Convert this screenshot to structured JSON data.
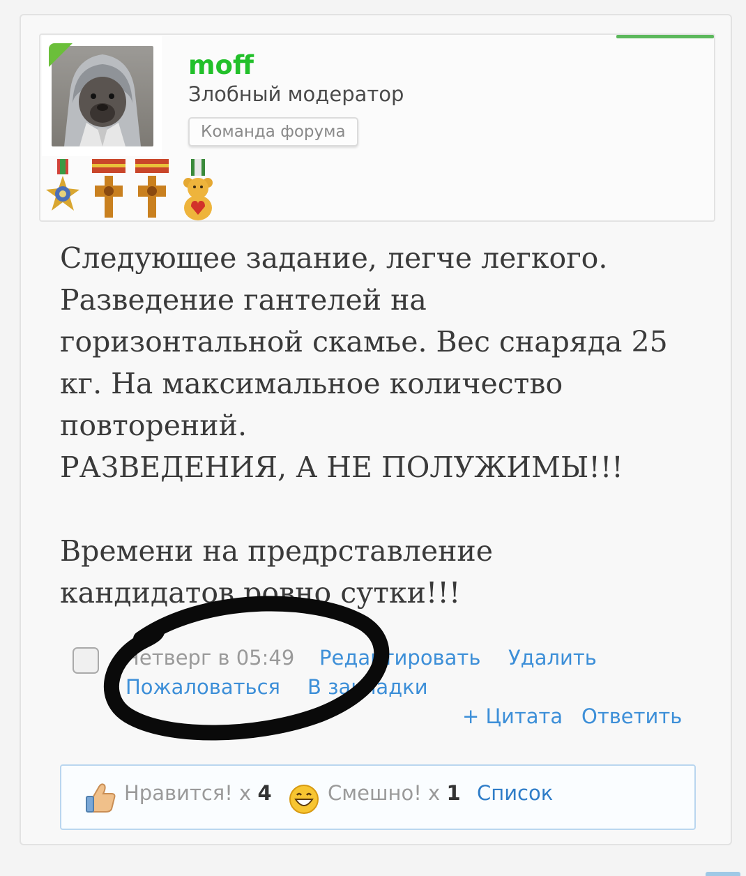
{
  "author": {
    "username": "moff",
    "title": "Злобный модератор",
    "group": "Команда форума",
    "medals": [
      "order-star-medal",
      "cross-medal",
      "cross-medal",
      "teddy-bear-medal"
    ]
  },
  "post": {
    "text": "Следующее задание, легче легкого.\nРазведение гантелей на\nгоризонтальной скамье. Вес снаряда 25\nкг. На максимальное количество\nповторений.\nРАЗВЕДЕНИЯ, А НЕ ПОЛУЖИМЫ!!!\n\nВремени на предрставление\nкандидатов ровно сутки!!!",
    "date": "Четверг в 05:49",
    "actions": {
      "edit": "Редактировать",
      "delete": "Удалить",
      "report": "Пожаловаться",
      "bookmark": "В закладки",
      "quote": "+ Цитата",
      "reply": "Ответить"
    }
  },
  "reactions": {
    "like_label": "Нравится! x",
    "like_count": "4",
    "funny_label": "Смешно! x",
    "funny_count": "1",
    "list_label": "Список"
  },
  "colors": {
    "username": "#22c02a",
    "link": "#3d8fd8",
    "accent_green": "#5cb85c"
  }
}
